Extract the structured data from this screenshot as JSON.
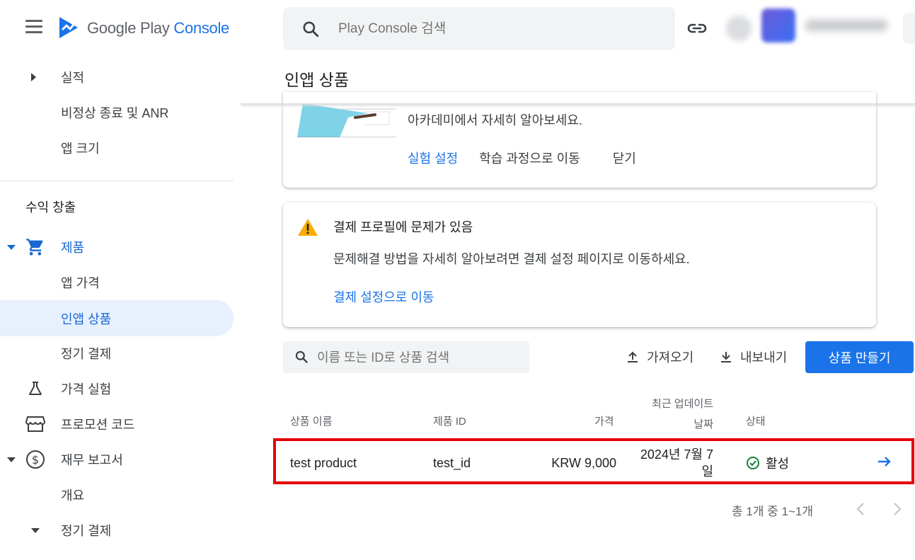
{
  "app": {
    "logo_google_play": "Google Play",
    "logo_console": "Console"
  },
  "colors": {
    "accent": "#1a73e8",
    "active_nav_bg": "#e8f0fe",
    "status_green": "#188038",
    "warning_yellow": "#f9ab00",
    "highlight_red": "#e8000b"
  },
  "search": {
    "placeholder": "Play Console 검색"
  },
  "page": {
    "title": "인앱 상품"
  },
  "sidebar": {
    "items": [
      {
        "label": "실적"
      },
      {
        "label": "비정상 종료 및 ANR"
      },
      {
        "label": "앱 크기"
      },
      {
        "label": "제품",
        "expanded": true
      },
      {
        "label": "앱 가격"
      },
      {
        "label": "인앱 상품",
        "active": true
      },
      {
        "label": "정기 결제"
      },
      {
        "label": "가격 실험"
      },
      {
        "label": "프로모션 코드"
      },
      {
        "label": "재무 보고서",
        "expanded": true
      },
      {
        "label": "개요"
      },
      {
        "label": "정기 결제"
      }
    ],
    "section_monetization": "수익 창출"
  },
  "promo_card": {
    "text": "아카데미에서 자세히 알아보세요.",
    "action_primary": "실험 설정",
    "action_course": "학습 과정으로 이동",
    "action_close": "닫기"
  },
  "alert_card": {
    "title": "결제 프로필에 문제가 있음",
    "description": "문제해결 방법을 자세히 알아보려면 결제 설정 페이지로 이동하세요.",
    "link": "결제 설정으로 이동"
  },
  "toolbar": {
    "filter_placeholder": "이름 또는 ID로 상품 검색",
    "import_label": "가져오기",
    "export_label": "내보내기",
    "create_label": "상품 만들기"
  },
  "table": {
    "headers": {
      "name": "상품 이름",
      "id": "제품 ID",
      "price": "가격",
      "updated_line1": "최근 업데이트",
      "updated_line2": "날짜",
      "status": "상태"
    },
    "rows": [
      {
        "name": "test product",
        "id": "test_id",
        "price": "KRW 9,000",
        "updated_line1": "2024년 7월 7",
        "updated_line2": "일",
        "status": "활성"
      }
    ]
  },
  "pagination": {
    "summary": "총 1개 중 1~1개"
  }
}
